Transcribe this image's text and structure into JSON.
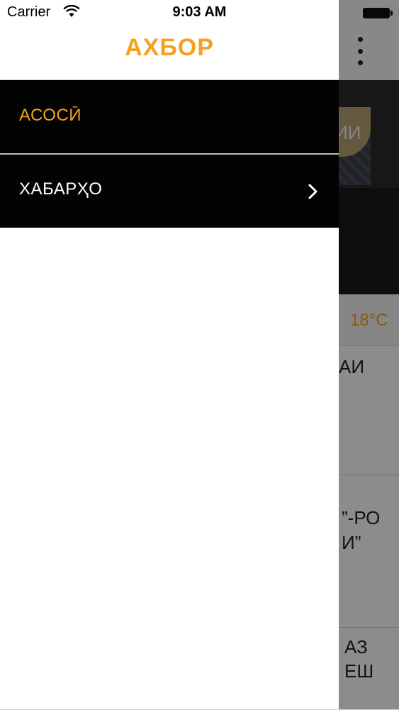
{
  "status_bar": {
    "carrier": "Carrier",
    "time": "9:03 AM"
  },
  "drawer": {
    "title": "АХБОР",
    "items": [
      {
        "label": "АСОСӢ",
        "active": true,
        "has_children": false
      },
      {
        "label": "ХАБАРҲО",
        "active": false,
        "has_children": true
      }
    ]
  },
  "background": {
    "hero_title_fragment": "ИИ",
    "temperature": "18°C",
    "rows": [
      {
        "lines": [
          "АИ"
        ]
      },
      {
        "lines": [
          "”-РО",
          "И”"
        ]
      },
      {
        "lines": [
          "АЗ",
          "ЕШ"
        ]
      }
    ]
  },
  "icons": {
    "wifi": "wifi-icon",
    "battery": "battery-icon",
    "more": "more-vertical-icon",
    "chevron": "chevron-right-icon"
  },
  "colors": {
    "accent": "#f5a11c",
    "menu_bg": "#030303",
    "temperature": "#f5a623"
  }
}
